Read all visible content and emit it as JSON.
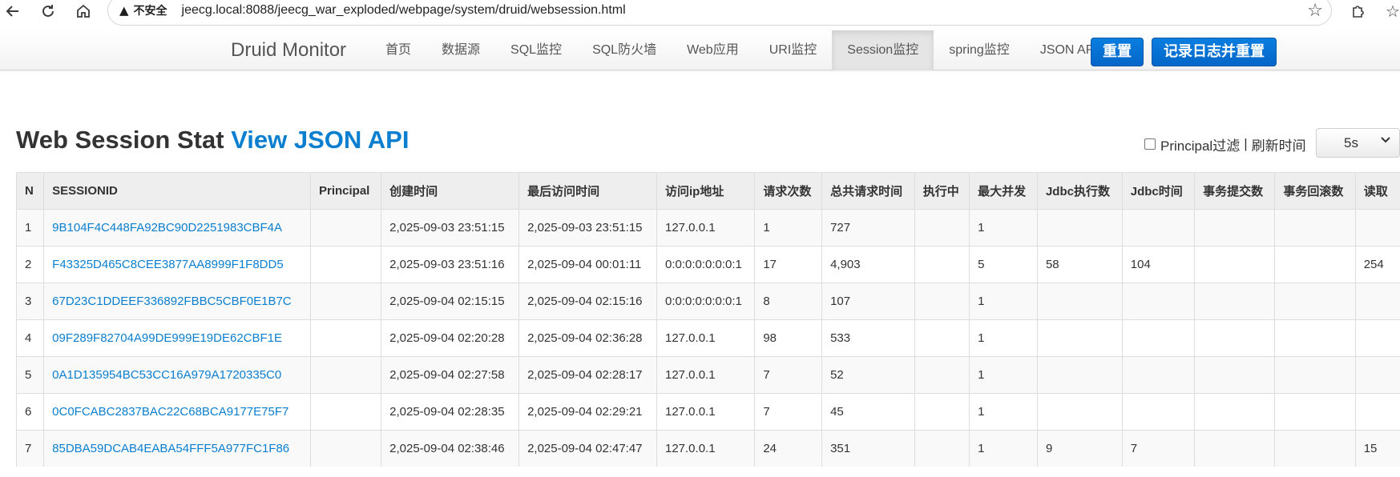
{
  "browser": {
    "security_label": "不安全",
    "url": "jeecg.local:8088/jeecg_war_exploded/webpage/system/druid/websession.html"
  },
  "navbar": {
    "brand": "Druid Monitor",
    "items": [
      {
        "label": "首页"
      },
      {
        "label": "数据源"
      },
      {
        "label": "SQL监控"
      },
      {
        "label": "SQL防火墙"
      },
      {
        "label": "Web应用"
      },
      {
        "label": "URI监控"
      },
      {
        "label": "Session监控",
        "active": true
      },
      {
        "label": "spring监控"
      },
      {
        "label": "JSON API"
      }
    ],
    "reset_button": "重置",
    "log_reset_button": "记录日志并重置"
  },
  "page": {
    "title": "Web Session Stat",
    "api_link": "View JSON API",
    "principal_filter_label": "Principal过滤",
    "separator": "|",
    "refresh_label": "刷新时间",
    "refresh_value": "5s"
  },
  "table": {
    "columns": [
      "N",
      "SESSIONID",
      "Principal",
      "创建时间",
      "最后访问时间",
      "访问ip地址",
      "请求次数",
      "总共请求时间",
      "执行中",
      "最大并发",
      "Jdbc执行数",
      "Jdbc时间",
      "事务提交数",
      "事务回滚数",
      "读取"
    ],
    "rows": [
      [
        "1",
        "9B104F4C448FA92BC90D2251983CBF4A",
        "",
        "2,025-09-03 23:51:15",
        "2,025-09-03 23:51:15",
        "127.0.0.1",
        "1",
        "727",
        "",
        "1",
        "",
        "",
        "",
        "",
        ""
      ],
      [
        "2",
        "F43325D465C8CEE3877AA8999F1F8DD5",
        "",
        "2,025-09-03 23:51:16",
        "2,025-09-04 00:01:11",
        "0:0:0:0:0:0:0:1",
        "17",
        "4,903",
        "",
        "5",
        "58",
        "104",
        "",
        "",
        "254"
      ],
      [
        "3",
        "67D23C1DDEEF336892FBBC5CBF0E1B7C",
        "",
        "2,025-09-04 02:15:15",
        "2,025-09-04 02:15:16",
        "0:0:0:0:0:0:0:1",
        "8",
        "107",
        "",
        "1",
        "",
        "",
        "",
        "",
        ""
      ],
      [
        "4",
        "09F289F82704A99DE999E19DE62CBF1E",
        "",
        "2,025-09-04 02:20:28",
        "2,025-09-04 02:36:28",
        "127.0.0.1",
        "98",
        "533",
        "",
        "1",
        "",
        "",
        "",
        "",
        ""
      ],
      [
        "5",
        "0A1D135954BC53CC16A979A1720335C0",
        "",
        "2,025-09-04 02:27:58",
        "2,025-09-04 02:28:17",
        "127.0.0.1",
        "7",
        "52",
        "",
        "1",
        "",
        "",
        "",
        "",
        ""
      ],
      [
        "6",
        "0C0FCABC2837BAC22C68BCA9177E75F7",
        "",
        "2,025-09-04 02:28:35",
        "2,025-09-04 02:29:21",
        "127.0.0.1",
        "7",
        "45",
        "",
        "1",
        "",
        "",
        "",
        "",
        ""
      ],
      [
        "7",
        "85DBA59DCAB4EABA54FFF5A977FC1F86",
        "",
        "2,025-09-04 02:38:46",
        "2,025-09-04 02:47:47",
        "127.0.0.1",
        "24",
        "351",
        "",
        "1",
        "9",
        "7",
        "",
        "",
        "15"
      ]
    ]
  },
  "colors": {
    "link": "#0b7fcf",
    "button": "#0466c8",
    "header_bg": "#eeeeee",
    "active_nav_bg": "#e5e5e5"
  },
  "icons": [
    "back-icon",
    "reload-icon",
    "home-icon",
    "warning-icon",
    "star-icon",
    "extension-icon",
    "chevron-down-icon"
  ]
}
